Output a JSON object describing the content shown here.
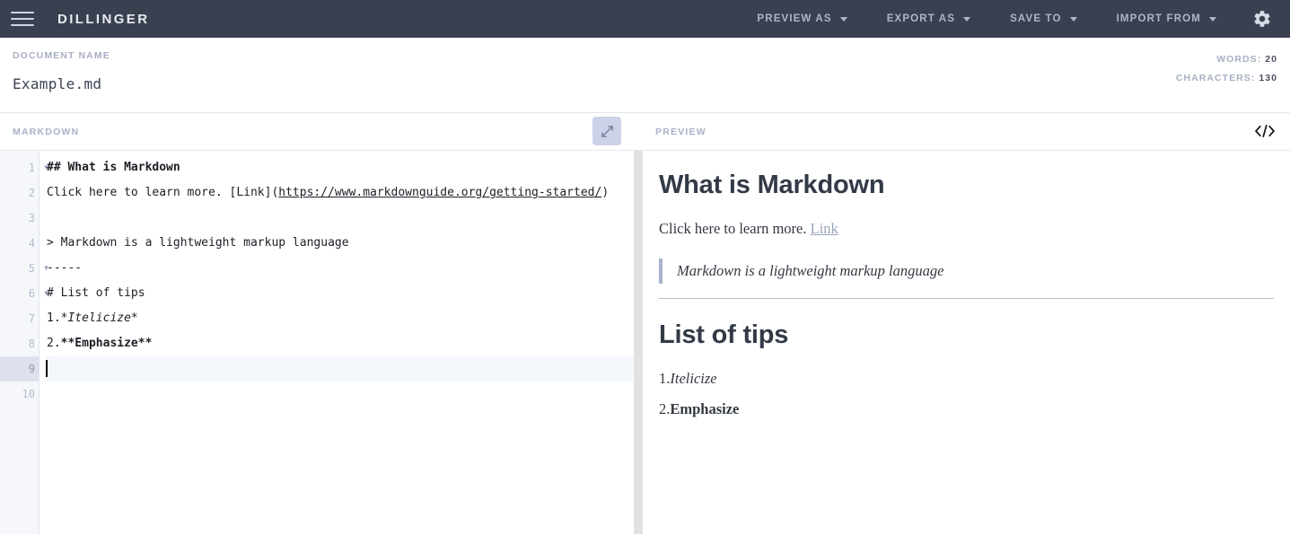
{
  "navbar": {
    "brand": "DILLINGER",
    "menu_icon": "hamburger-icon",
    "items": [
      {
        "label": "PREVIEW AS"
      },
      {
        "label": "EXPORT AS"
      },
      {
        "label": "SAVE TO"
      },
      {
        "label": "IMPORT FROM"
      }
    ],
    "settings_icon": "gear-icon",
    "background": "#39404f"
  },
  "docbar": {
    "label": "DOCUMENT NAME",
    "name_value": "Example.md",
    "name_placeholder": "Document name",
    "words_label": "WORDS:",
    "words_value": "20",
    "characters_label": "CHARACTERS:",
    "characters_value": "130"
  },
  "editor": {
    "title": "MARKDOWN",
    "expand_icon": "expand-arrows-icon",
    "active_line": 9,
    "lines": [
      {
        "n": "1",
        "fold": true,
        "segments": [
          {
            "t": "## What is Markdown",
            "style": "bold"
          }
        ]
      },
      {
        "n": "2",
        "fold": false,
        "segments": [
          {
            "t": "Click here to learn more. [Link](",
            "style": ""
          },
          {
            "t": "https://www.markdownguide.org/getting-started/",
            "style": "url"
          },
          {
            "t": ")",
            "style": ""
          }
        ]
      },
      {
        "n": "3",
        "fold": false,
        "segments": []
      },
      {
        "n": "4",
        "fold": false,
        "segments": [
          {
            "t": "> Markdown is a lightweight markup language",
            "style": ""
          }
        ]
      },
      {
        "n": "5",
        "fold": true,
        "segments": [
          {
            "t": "-----",
            "style": ""
          }
        ]
      },
      {
        "n": "6",
        "fold": true,
        "segments": [
          {
            "t": "# List of tips",
            "style": ""
          }
        ]
      },
      {
        "n": "7",
        "fold": false,
        "segments": [
          {
            "t": "1.",
            "style": ""
          },
          {
            "t": "*Itelicize*",
            "style": "ital"
          }
        ]
      },
      {
        "n": "8",
        "fold": false,
        "segments": [
          {
            "t": "2.",
            "style": ""
          },
          {
            "t": "**Emphasize**",
            "style": "bold"
          }
        ]
      },
      {
        "n": "9",
        "fold": false,
        "segments": []
      },
      {
        "n": "10",
        "fold": false,
        "segments": []
      }
    ]
  },
  "preview": {
    "title": "PREVIEW",
    "code_icon": "code-brackets-icon",
    "heading1": "What is Markdown",
    "paragraph_text": "Click here to learn more.",
    "paragraph_link": "Link",
    "blockquote": "Markdown is a lightweight markup language",
    "heading2": "List of tips",
    "list": [
      {
        "num": "1.",
        "text": "Itelicize",
        "style": "italic"
      },
      {
        "num": "2.",
        "text": "Emphasize",
        "style": "bold"
      }
    ]
  }
}
